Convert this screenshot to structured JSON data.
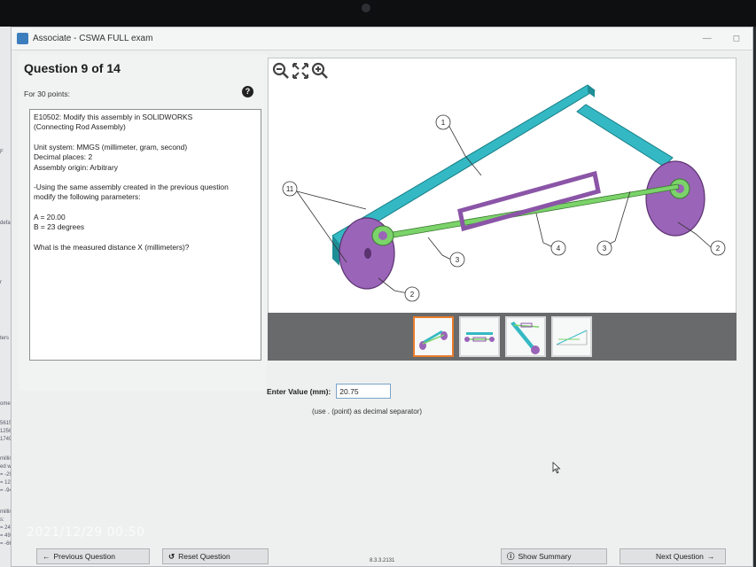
{
  "window": {
    "title": "Associate - CSWA FULL exam"
  },
  "background_app": {
    "snippets": [
      "F",
      "defau",
      "r",
      "ters",
      "oments",
      "561512",
      "125659",
      "174951",
      "millimet",
      "ed with tl",
      "= -2958.",
      "= 12565",
      "= -941.9",
      "millimete",
      "s:",
      "= 24585",
      "= 49904",
      "= -6628"
    ]
  },
  "question": {
    "title": "Question 9 of 14",
    "points": "For 30 points:",
    "help_icon": "question-circle-icon",
    "lines": [
      "E10502:  Modify this assembly in SOLIDWORKS",
      "(Connecting Rod Assembly)",
      "",
      "Unit system: MMGS (millimeter, gram, second)",
      "Decimal places: 2",
      "Assembly origin: Arbitrary",
      "",
      "-Using the same assembly created in the previous question",
      "modify the following parameters:",
      "",
      "A = 20.00",
      "B = 23 degrees",
      "",
      "What is the measured distance X (millimeters)?"
    ]
  },
  "viewer": {
    "tools": [
      "zoom-out-icon",
      "fit-icon",
      "zoom-in-icon"
    ],
    "callouts": [
      "1",
      "11",
      "2",
      "2",
      "3",
      "3",
      "4"
    ],
    "thumbnails": [
      "thumbnail-1",
      "thumbnail-2",
      "thumbnail-3",
      "thumbnail-4"
    ],
    "selected_thumbnail": 0,
    "colors": {
      "link": "#34b9c4",
      "disc": "#9a64b8",
      "rod": "#7bd36a",
      "sleeve": "#8b55a7"
    }
  },
  "answer": {
    "label": "Enter Value (mm):",
    "value": "20.75",
    "hint": "(use . (point) as decimal separator)"
  },
  "footer": {
    "previous": "Previous Question",
    "reset": "Reset Question",
    "version": "8.3.3.2131",
    "summary": "Show Summary",
    "next": "Next Question"
  },
  "photo_timestamp": "2021/12/29 00:50"
}
